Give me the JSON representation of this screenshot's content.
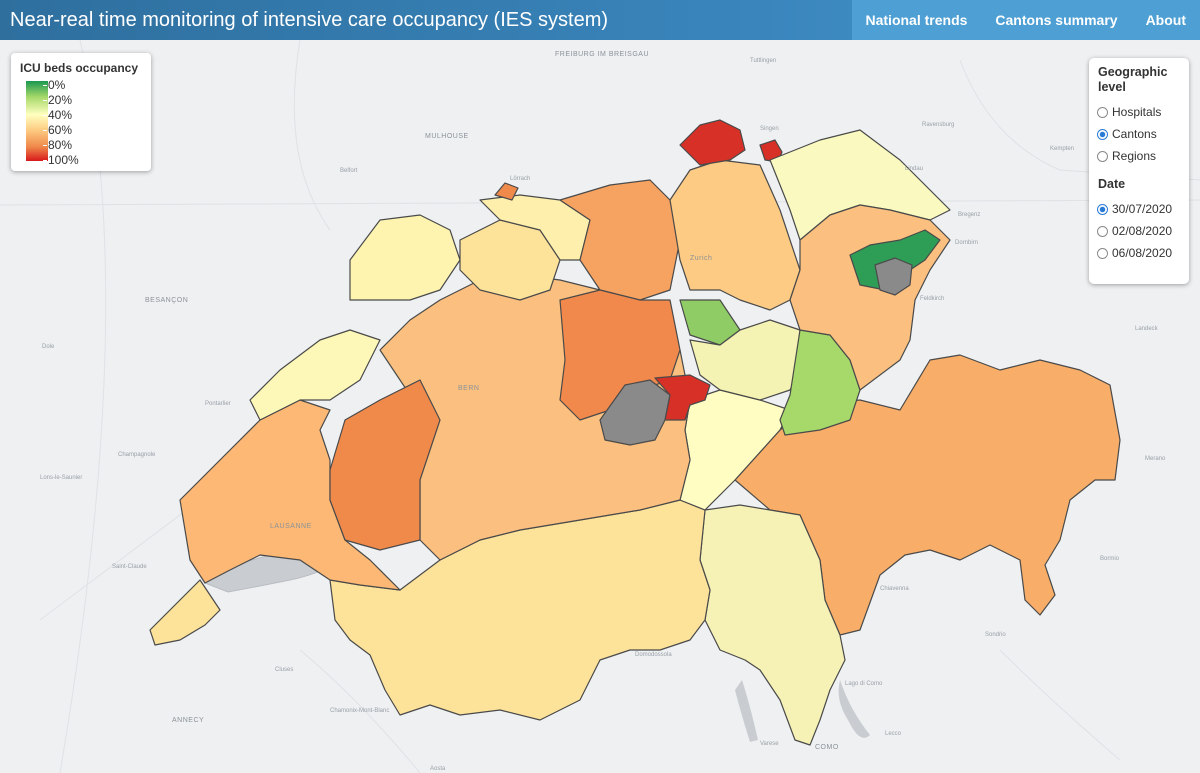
{
  "header": {
    "title": "Near-real time monitoring of intensive care occupancy (IES system)",
    "nav": [
      "National trends",
      "Cantons summary",
      "About"
    ]
  },
  "legend": {
    "title": "ICU beds occupancy",
    "ticks": [
      "0%",
      "20%",
      "40%",
      "60%",
      "80%",
      "100%"
    ],
    "colors": [
      "#1a9850",
      "#a6d96a",
      "#ffffbf",
      "#fdc980",
      "#f08a4b",
      "#d7191c"
    ]
  },
  "controls": {
    "geo_title": "Geographic level",
    "geo_options": [
      "Hospitals",
      "Cantons",
      "Regions"
    ],
    "geo_selected": "Cantons",
    "date_title": "Date",
    "date_options": [
      "30/07/2020",
      "02/08/2020",
      "06/08/2020"
    ],
    "date_selected": "30/07/2020"
  },
  "map_labels": [
    "FREIBURG IM BREISGAU",
    "MULHOUSE",
    "BESANÇON",
    "Dole",
    "Belfort",
    "Lörrach",
    "Zurich",
    "BERN",
    "LAUSANNE",
    "Chiavenna",
    "Sondrio",
    "Domodossola",
    "Lago di Como",
    "Varese",
    "COMO",
    "Lecco",
    "ANNECY",
    "Cluses",
    "Chamonix-Mont-Blanc",
    "Pontarlier",
    "Champagnole",
    "Lons-le-Saunier",
    "Saint-Claude",
    "Feldkirch",
    "Landeck",
    "Lindau",
    "Tuttlingen",
    "Singen",
    "Ravensburg",
    "Kempten",
    "Bregenz",
    "Dornbirn",
    "Bormio",
    "Merano",
    "Aosta"
  ]
}
